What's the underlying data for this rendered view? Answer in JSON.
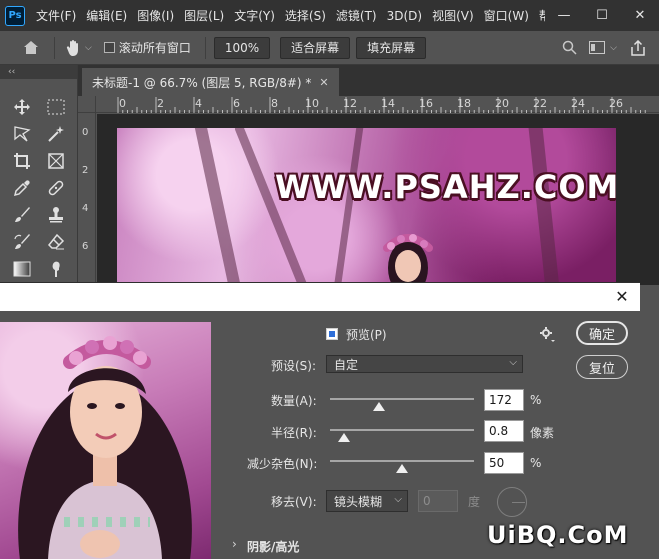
{
  "app": {
    "logo_text": "Ps"
  },
  "menubar": {
    "items": [
      "文件(F)",
      "编辑(E)",
      "图像(I)",
      "图层(L)",
      "文字(Y)",
      "选择(S)",
      "滤镜(T)",
      "3D(D)",
      "视图(V)",
      "窗口(W)",
      "帮"
    ],
    "minimize": "—",
    "maximize": "☐",
    "close": "✕"
  },
  "options_bar": {
    "scroll_all_label": "滚动所有窗口",
    "zoom_100": "100%",
    "fit_screen": "适合屏幕",
    "fill_screen": "填充屏幕"
  },
  "toolbar": {
    "collapse": "‹‹"
  },
  "document": {
    "tab_title": "未标题-1 @ 66.7% (图层 5, RGB/8#) *",
    "tab_close": "✕",
    "ruler_h_labels": [
      "0",
      "2",
      "4",
      "6",
      "8",
      "10",
      "12",
      "14",
      "16",
      "18",
      "20",
      "22",
      "24",
      "26"
    ],
    "ruler_v_labels": [
      "0",
      "2",
      "4",
      "6"
    ],
    "image_watermark": "WWW.PSAHZ.COM"
  },
  "dialog": {
    "close": "✕",
    "preview_label": "预览(P)",
    "preview_checked": true,
    "ok_button": "确定",
    "reset_button": "复位",
    "preset_label": "预设(S):",
    "preset_value": "自定",
    "amount_label": "数量(A):",
    "amount_value": "172",
    "amount_unit": "%",
    "amount_fraction": 0.34,
    "radius_label": "半径(R):",
    "radius_value": "0.8",
    "radius_unit": "像素",
    "radius_fraction": 0.1,
    "noise_label": "减少杂色(N):",
    "noise_value": "50",
    "noise_unit": "%",
    "noise_fraction": 0.5,
    "remove_label": "移去(V):",
    "remove_value": "镜头模糊",
    "angle_value": "0",
    "angle_unit": "度",
    "shadow_section": "阴影/高光"
  },
  "bottom_watermark": "UiBQ.CoM"
}
